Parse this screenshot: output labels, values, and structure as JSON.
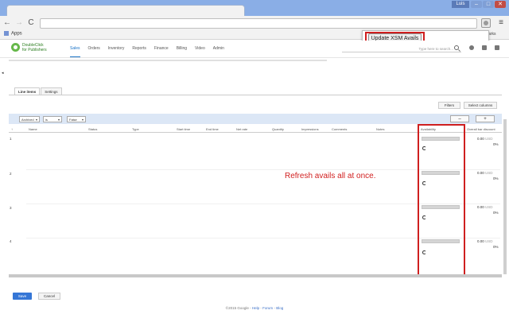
{
  "browser": {
    "user_badge": "Luis",
    "win_min": "–",
    "win_max": "□",
    "win_close": "✕",
    "back_icon": "←",
    "forward_icon": "→",
    "reload_icon": "C",
    "menu_icon": "≡",
    "apps_label": "Apps",
    "other_bookmarks_fragment": "arks"
  },
  "extension_popup": {
    "button_label": "Update XSM Avails"
  },
  "app": {
    "logo_line1": "DoubleClick",
    "logo_line2": "for Publishers",
    "nav_items": [
      "Sales",
      "Orders",
      "Inventory",
      "Reports",
      "Finance",
      "Billing",
      "Video",
      "Admin"
    ],
    "search_placeholder": "Type here to search..."
  },
  "left_arrow": "◂",
  "subtabs": [
    "Line items",
    "Settings"
  ],
  "toolbar": {
    "filters_label": "Filters",
    "columns_label": "Select columns",
    "minus_label": "–",
    "plus_label": "+"
  },
  "filter": {
    "field": "Archived",
    "operator": "is",
    "value": "False"
  },
  "table": {
    "sort_icon": "↑",
    "columns": [
      "Name",
      "Status",
      "Type",
      "Start time",
      "End time",
      "Net rate",
      "Quantity",
      "Impressions",
      "Comments",
      "Notes",
      "Availability",
      "Overall bar discount"
    ],
    "rows": [
      {
        "num": "1",
        "amount": "0.00",
        "currency": "USD",
        "pct": "0%"
      },
      {
        "num": "2",
        "amount": "0.00",
        "currency": "USD",
        "pct": "0%"
      },
      {
        "num": "3",
        "amount": "0.00",
        "currency": "USD",
        "pct": "0%"
      },
      {
        "num": "4",
        "amount": "0.00",
        "currency": "USD",
        "pct": "0%"
      }
    ]
  },
  "annotation": "Refresh avails all at once.",
  "actions": {
    "save": "Save",
    "cancel": "Cancel"
  },
  "footer": {
    "copyright": "©2015 Google -",
    "help": "Help",
    "sep1": " - ",
    "forum": "Forum",
    "sep2": " - ",
    "blog": "Blog"
  },
  "colors": {
    "highlight": "#cf1f1f",
    "active_nav": "#1a73c6",
    "save_button": "#3576d6",
    "filter_bar": "#dce7f6"
  }
}
